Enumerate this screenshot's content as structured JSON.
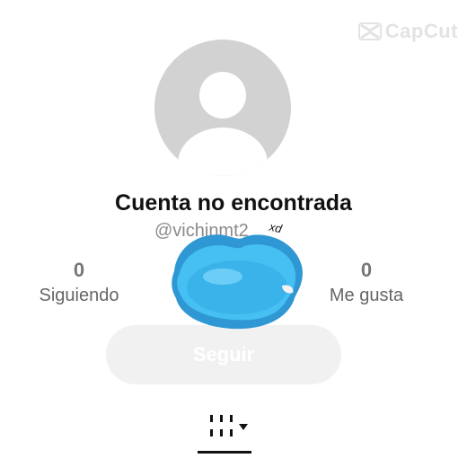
{
  "watermark": {
    "text": "CapCut",
    "icon": "capcut-logo-icon"
  },
  "profile": {
    "avatar_icon": "default-avatar-icon",
    "title": "Cuenta no encontrada",
    "username": "@vichinmt2",
    "overlay_text": "xd",
    "overlay_icon": "blue-lips-sticker"
  },
  "stats": {
    "following": {
      "value": "0",
      "label": "Siguiendo"
    },
    "likes": {
      "value": "0",
      "label": "Me gusta"
    }
  },
  "follow_button": {
    "label": "Seguir"
  },
  "tabs": {
    "active_icon": "grid-videos-icon",
    "dropdown_icon": "caret-down-icon"
  },
  "colors": {
    "avatar_bg": "#d2d2d2",
    "sticker_blue": "#3ab2ea",
    "button_bg": "#f1f1f1"
  }
}
